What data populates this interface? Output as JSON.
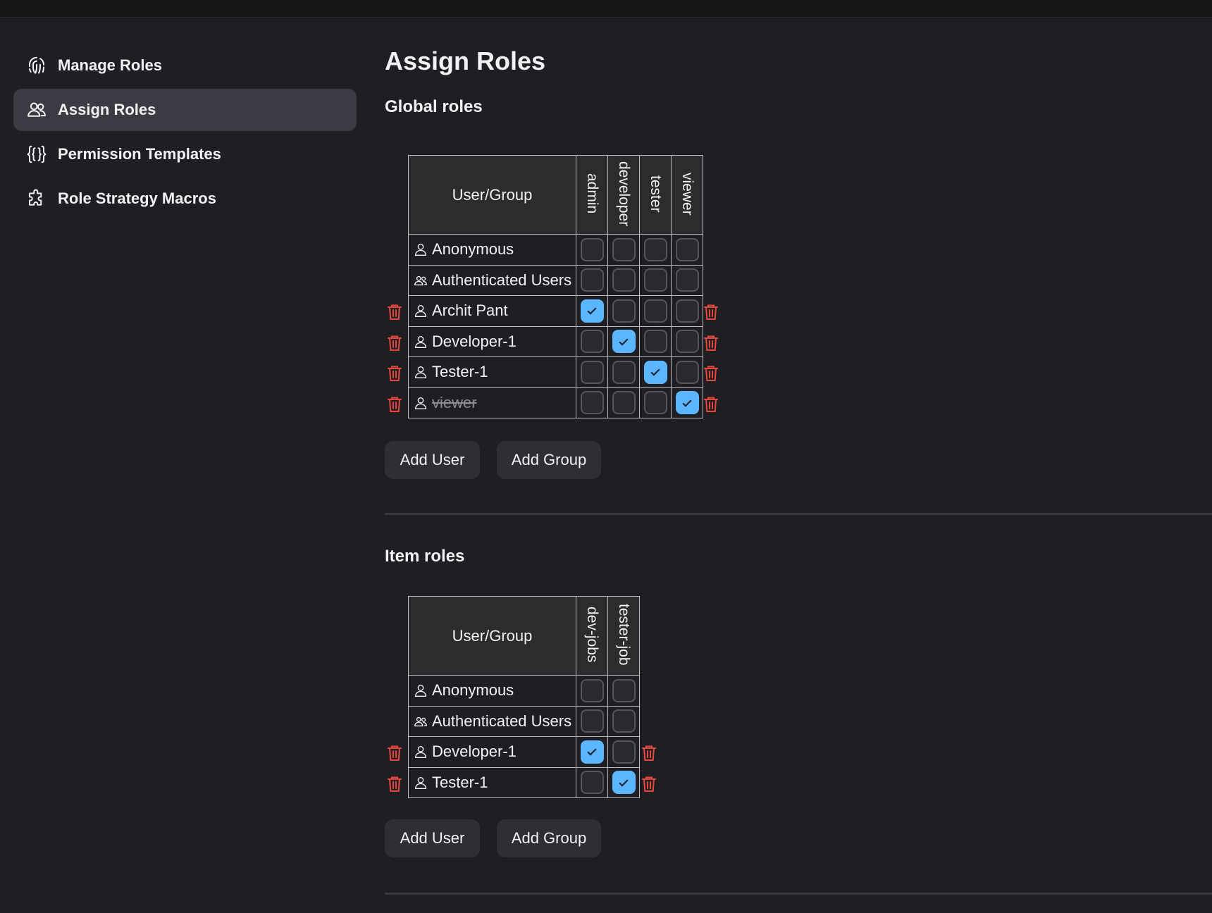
{
  "sidebar": {
    "items": [
      {
        "label": "Manage Roles",
        "icon": "fingerprint-icon"
      },
      {
        "label": "Assign Roles",
        "icon": "users-icon",
        "active": true
      },
      {
        "label": "Permission Templates",
        "icon": "braces-icon"
      },
      {
        "label": "Role Strategy Macros",
        "icon": "puzzle-icon"
      }
    ]
  },
  "main": {
    "title": "Assign Roles",
    "global": {
      "title": "Global roles",
      "user_group_header": "User/Group",
      "roles": [
        "admin",
        "developer",
        "tester",
        "viewer"
      ],
      "rows": [
        {
          "name": "Anonymous",
          "type": "user",
          "deletable": false,
          "checked": [
            false,
            false,
            false,
            false
          ]
        },
        {
          "name": "Authenticated Users",
          "type": "group",
          "deletable": false,
          "checked": [
            false,
            false,
            false,
            false
          ]
        },
        {
          "name": "Archit Pant",
          "type": "user",
          "deletable": true,
          "checked": [
            true,
            false,
            false,
            false
          ]
        },
        {
          "name": "Developer-1",
          "type": "user",
          "deletable": true,
          "checked": [
            false,
            true,
            false,
            false
          ]
        },
        {
          "name": "Tester-1",
          "type": "user",
          "deletable": true,
          "checked": [
            false,
            false,
            true,
            false
          ]
        },
        {
          "name": "viewer",
          "type": "user",
          "deletable": true,
          "strikethrough": true,
          "checked": [
            false,
            false,
            false,
            true
          ]
        }
      ],
      "add_user": "Add User",
      "add_group": "Add Group"
    },
    "item": {
      "title": "Item roles",
      "user_group_header": "User/Group",
      "roles": [
        "dev-jobs",
        "tester-job"
      ],
      "rows": [
        {
          "name": "Anonymous",
          "type": "user",
          "deletable": false,
          "checked": [
            false,
            false
          ]
        },
        {
          "name": "Authenticated Users",
          "type": "group",
          "deletable": false,
          "checked": [
            false,
            false
          ]
        },
        {
          "name": "Developer-1",
          "type": "user",
          "deletable": true,
          "checked": [
            true,
            false
          ]
        },
        {
          "name": "Tester-1",
          "type": "user",
          "deletable": true,
          "checked": [
            false,
            true
          ]
        }
      ],
      "add_user": "Add User",
      "add_group": "Add Group"
    }
  },
  "colors": {
    "accent": "#5cb5ff",
    "danger": "#e8473c",
    "background": "#1f1f23"
  }
}
